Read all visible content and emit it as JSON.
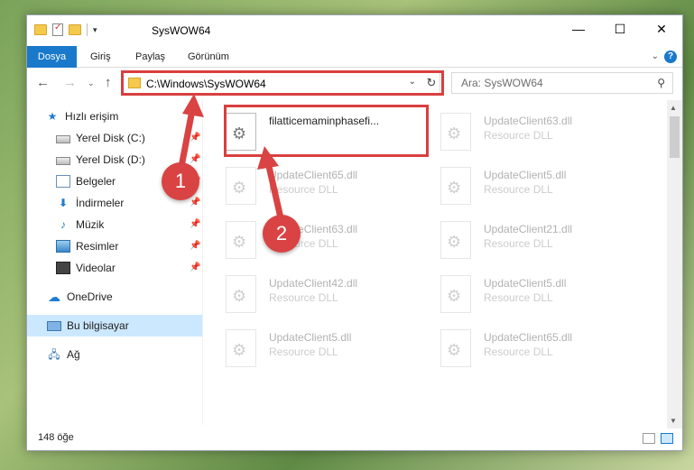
{
  "window": {
    "title": "SysWOW64",
    "minimize": "—",
    "maximize": "☐",
    "close": "✕"
  },
  "ribbon": {
    "tabs": [
      "Dosya",
      "Giriş",
      "Paylaş",
      "Görünüm"
    ],
    "help": "?"
  },
  "nav": {
    "back": "←",
    "forward": "→",
    "recent": "⌄",
    "up": "↑",
    "refresh": "↻",
    "dropdown": "⌄"
  },
  "address": {
    "path": "C:\\Windows\\SysWOW64"
  },
  "search": {
    "placeholder": "Ara: SysWOW64",
    "icon": "search-icon"
  },
  "sidebar": {
    "items": [
      {
        "label": "Hızlı erişim",
        "icon": "star-icon",
        "pinned": false
      },
      {
        "label": "Yerel Disk (C:)",
        "icon": "disk-icon",
        "pinned": true
      },
      {
        "label": "Yerel Disk (D:)",
        "icon": "disk-icon",
        "pinned": true
      },
      {
        "label": "Belgeler",
        "icon": "documents-icon",
        "pinned": true
      },
      {
        "label": "İndirmeler",
        "icon": "download-icon",
        "pinned": true
      },
      {
        "label": "Müzik",
        "icon": "music-icon",
        "pinned": true
      },
      {
        "label": "Resimler",
        "icon": "pictures-icon",
        "pinned": true
      },
      {
        "label": "Videolar",
        "icon": "video-icon",
        "pinned": true
      },
      {
        "label": "OneDrive",
        "icon": "cloud-icon",
        "pinned": false
      },
      {
        "label": "Bu bilgisayar",
        "icon": "computer-icon",
        "pinned": false,
        "selected": true
      },
      {
        "label": "Ağ",
        "icon": "network-icon",
        "pinned": false
      }
    ]
  },
  "files": [
    {
      "name": "filatticemaminphasefi...",
      "type": "",
      "faded": false
    },
    {
      "name": "UpdateClient63.dll",
      "type": "Resource DLL",
      "faded": true
    },
    {
      "name": "UpdateClient65.dll",
      "type": "Resource DLL",
      "faded": true
    },
    {
      "name": "UpdateClient5.dll",
      "type": "Resource DLL",
      "faded": true
    },
    {
      "name": "UpdateClient63.dll",
      "type": "Resource DLL",
      "faded": true
    },
    {
      "name": "UpdateClient21.dll",
      "type": "Resource DLL",
      "faded": true
    },
    {
      "name": "UpdateClient42.dll",
      "type": "Resource DLL",
      "faded": true
    },
    {
      "name": "UpdateClient5.dll",
      "type": "Resource DLL",
      "faded": true
    },
    {
      "name": "UpdateClient5.dll",
      "type": "Resource DLL",
      "faded": true
    },
    {
      "name": "UpdateClient65.dll",
      "type": "Resource DLL",
      "faded": true
    }
  ],
  "status": {
    "count": "148 öğe"
  },
  "callouts": [
    "1",
    "2"
  ],
  "colors": {
    "accent": "#1979ca",
    "highlight": "#d93f3f",
    "selected": "#cce8ff"
  }
}
